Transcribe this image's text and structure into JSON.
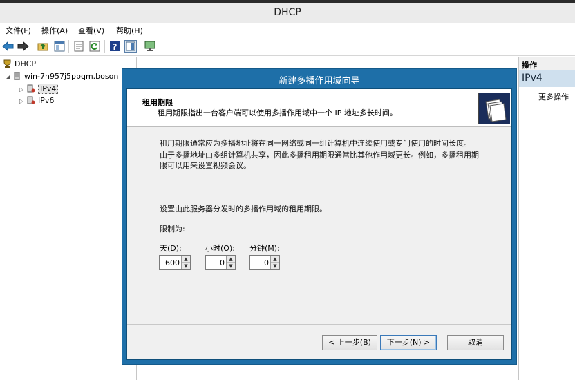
{
  "window": {
    "title": "DHCP"
  },
  "menu": [
    "文件(F)",
    "操作(A)",
    "查看(V)",
    "帮助(H)"
  ],
  "toolbar": {
    "icons": [
      "back-arrow-icon",
      "forward-arrow-icon",
      "folder-up-icon",
      "console-tree-icon",
      "properties-icon",
      "refresh-icon",
      "help-icon",
      "action-pane-icon",
      "monitor-icon"
    ]
  },
  "tree": {
    "root": "DHCP",
    "server": "win-7h957j5pbqm.boson",
    "children": [
      "IPv4",
      "IPv6"
    ]
  },
  "actions": {
    "header": "操作",
    "section": "IPv4",
    "more": "更多操作"
  },
  "wizard": {
    "title": "新建多播作用域向导",
    "header_title": "租用期限",
    "header_subtitle": "租用期限指出一台客户端可以使用多播作用域中一个 IP 地址多长时间。",
    "para1": "租用期限通常应为多播地址将在同一网络或同一组计算机中连续使用或专门使用的时间长度。",
    "para2_line1": "由于多播地址由多组计算机共享，因此多播租用期限通常比其他作用域更长。例如，多播租用期",
    "para2_line2": "限可以用来设置视频会议。",
    "instruction": "设置由此服务器分发时的多播作用域的租用期限。",
    "limit_label": "限制为:",
    "days_label": "天(D):",
    "hours_label": "小时(O):",
    "minutes_label": "分钟(M):",
    "days_value": "600",
    "hours_value": "0",
    "minutes_value": "0",
    "back_button": "< 上一步(B)",
    "next_button": "下一步(N) >",
    "cancel_button": "取消"
  },
  "colors": {
    "wizard_frame": "#1e6fa8",
    "selection": "#cfe0ee",
    "dialog_body": "#f0f0f0"
  }
}
